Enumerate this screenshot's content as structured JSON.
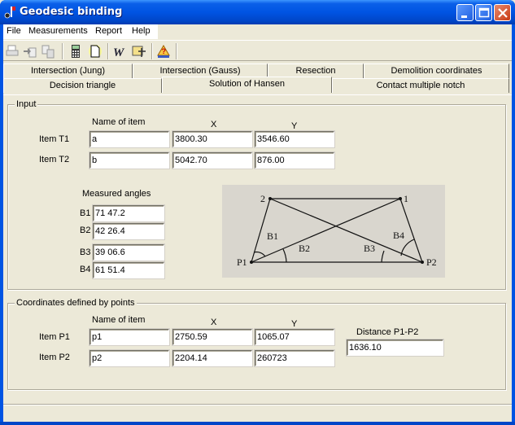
{
  "window": {
    "title": "Geodesic binding",
    "controls": [
      "minimize",
      "maximize",
      "close"
    ]
  },
  "menu": {
    "items": [
      "File",
      "Measurements",
      "Report",
      "Help"
    ]
  },
  "toolbar": {
    "icons": [
      "print-icon",
      "import-icon",
      "export-icon",
      "calculator-icon",
      "new-document-icon",
      "word-export-icon",
      "coordinates-icon",
      "help-book-icon"
    ]
  },
  "tabs": {
    "row1": [
      "Intersection (Jung)",
      "Intersection (Gauss)",
      "Resection",
      "Demolition coordinates"
    ],
    "row2": [
      "Decision triangle",
      "Solution of Hansen",
      "Contact multiple notch"
    ],
    "active": "Solution of Hansen"
  },
  "input": {
    "title": "Input",
    "col_name": "Name of item",
    "col_x": "X",
    "col_y": "Y",
    "rows": [
      {
        "label": "Item T1",
        "name": "a",
        "x": "3800.30",
        "y": "3546.60"
      },
      {
        "label": "Item T2",
        "name": "b",
        "x": "5042.70",
        "y": "876.00"
      }
    ],
    "angles_title": "Measured angles",
    "angles": [
      {
        "label": "B1",
        "value": "71 47.2"
      },
      {
        "label": "B2",
        "value": "42 26.4"
      },
      {
        "label": "B3",
        "value": "39 06.6"
      },
      {
        "label": "B4",
        "value": "61 51.4"
      }
    ]
  },
  "diagram": {
    "points": {
      "p1": "P1",
      "p2": "P2",
      "n1": "1",
      "n2": "2"
    },
    "angles": {
      "b1": "B1",
      "b2": "B2",
      "b3": "B3",
      "b4": "B4"
    }
  },
  "output": {
    "title": "Coordinates defined by points",
    "col_name": "Name of item",
    "col_x": "X",
    "col_y": "Y",
    "rows": [
      {
        "label": "Item P1",
        "name": "p1",
        "x": "2750.59",
        "y": "1065.07"
      },
      {
        "label": "Item P2",
        "name": "p2",
        "x": "2204.14",
        "y": "260723"
      }
    ],
    "distance_label": "Distance P1-P2",
    "distance_value": "1636.10"
  },
  "status": {
    "text": ""
  }
}
